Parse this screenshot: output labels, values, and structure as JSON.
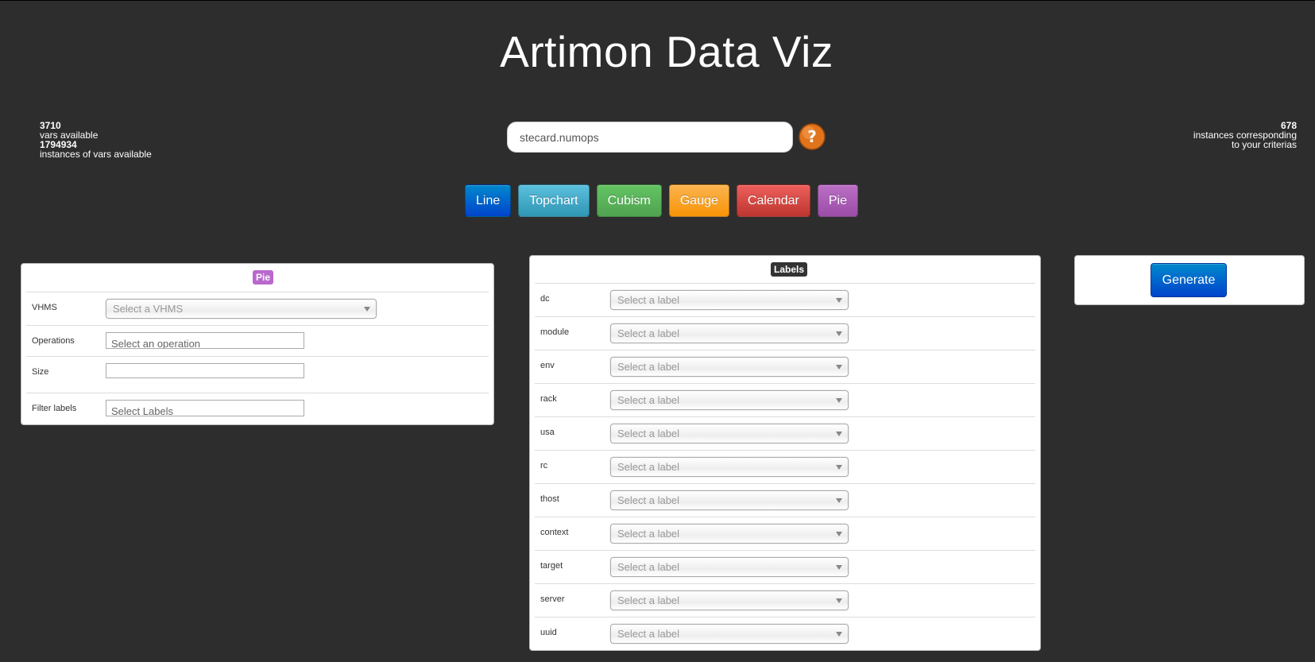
{
  "title": "Artimon Data Viz",
  "stats_left": {
    "vars_count": "3710",
    "vars_label": "vars available",
    "instances_count": "1794934",
    "instances_label": "instances of vars available"
  },
  "stats_right": {
    "count": "678",
    "line1": "instances corresponding",
    "line2": "to your criterias"
  },
  "search": {
    "value": "stecard.numops"
  },
  "chart_buttons": [
    {
      "label": "Line",
      "color": "#0055cc"
    },
    {
      "label": "Topchart",
      "color": "#49afcd"
    },
    {
      "label": "Cubism",
      "color": "#5bb75b"
    },
    {
      "label": "Gauge",
      "color": "#faa732"
    },
    {
      "label": "Calendar",
      "color": "#da4f49"
    },
    {
      "label": "Pie",
      "color": "#a95fb5"
    }
  ],
  "pie_panel": {
    "badge": "Pie",
    "badge_color": "#b968cc",
    "vhms_label": "VHMS",
    "vhms_placeholder": "Select a VHMS",
    "operations_label": "Operations",
    "operations_placeholder": "Select an operation",
    "size_label": "Size",
    "size_value": "",
    "filter_label": "Filter labels",
    "filter_placeholder": "Select Labels"
  },
  "labels_panel": {
    "badge": "Labels",
    "badge_color": "#333333",
    "placeholder": "Select a label",
    "rows": [
      "dc",
      "module",
      "env",
      "rack",
      "usa",
      "rc",
      "thost",
      "context",
      "target",
      "server",
      "uuid"
    ]
  },
  "generate": {
    "label": "Generate"
  }
}
